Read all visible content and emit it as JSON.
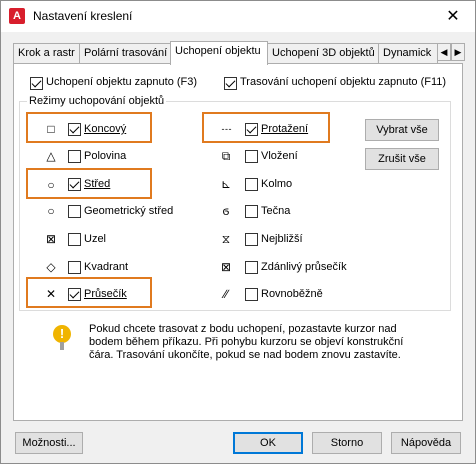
{
  "window": {
    "title": "Nastavení kreslení",
    "close_glyph": "✕",
    "app_icon_letter": "A"
  },
  "tabs": [
    {
      "label": "Krok a rastr",
      "active": false
    },
    {
      "label": "Polární trasování",
      "active": false
    },
    {
      "label": "Uchopení objektu",
      "active": true
    },
    {
      "label": "Uchopení 3D objektů",
      "active": false
    },
    {
      "label": "Dynamick",
      "active": false
    }
  ],
  "tab_scroll": {
    "left": "◀",
    "right": "▶"
  },
  "toggles": {
    "snap_on": {
      "label": "Uchopení objektu zapnuto (F3)",
      "checked": true
    },
    "tracking_on": {
      "label": "Trasování uchopení objektu zapnuto (F11)",
      "checked": true
    }
  },
  "group_label": "Režimy uchopování objektů",
  "modes_left": [
    {
      "label": "Koncový",
      "checked": true,
      "symbol": "□"
    },
    {
      "label": "Polovina",
      "checked": false,
      "symbol": "△"
    },
    {
      "label": "Střed",
      "checked": true,
      "symbol": "○"
    },
    {
      "label": "Geometrický střed",
      "checked": false,
      "symbol": "○"
    },
    {
      "label": "Uzel",
      "checked": false,
      "symbol": "⊠"
    },
    {
      "label": "Kvadrant",
      "checked": false,
      "symbol": "◇"
    },
    {
      "label": "Průsečík",
      "checked": true,
      "symbol": "✕"
    }
  ],
  "modes_right": [
    {
      "label": "Protažení",
      "checked": true,
      "symbol": "- - -"
    },
    {
      "label": "Vložení",
      "checked": false,
      "symbol": "⧉"
    },
    {
      "label": "Kolmo",
      "checked": false,
      "symbol": "⊾"
    },
    {
      "label": "Tečna",
      "checked": false,
      "symbol": "ϭ"
    },
    {
      "label": "Nejbližší",
      "checked": false,
      "symbol": "⧖"
    },
    {
      "label": "Zdánlivý průsečík",
      "checked": false,
      "symbol": "⊠"
    },
    {
      "label": "Rovnoběžně",
      "checked": false,
      "symbol": "∕∕"
    }
  ],
  "side_buttons": {
    "select_all": "Vybrat vše",
    "clear_all": "Zrušit vše"
  },
  "info": {
    "icon": "lightbulb-icon",
    "text": "Pokud chcete trasovat z bodu uchopení, pozastavte kurzor nad bodem během příkazu. Při pohybu kurzoru se objeví konstrukční čára. Trasování ukončíte, pokud se nad bodem znovu zastavíte."
  },
  "footer": {
    "options": "Možnosti...",
    "ok": "OK",
    "cancel": "Storno",
    "help": "Nápověda"
  },
  "colors": {
    "highlight": "#e07a1f",
    "title_bar": "#ffffff",
    "dialog_bg": "#f0f0f0"
  }
}
